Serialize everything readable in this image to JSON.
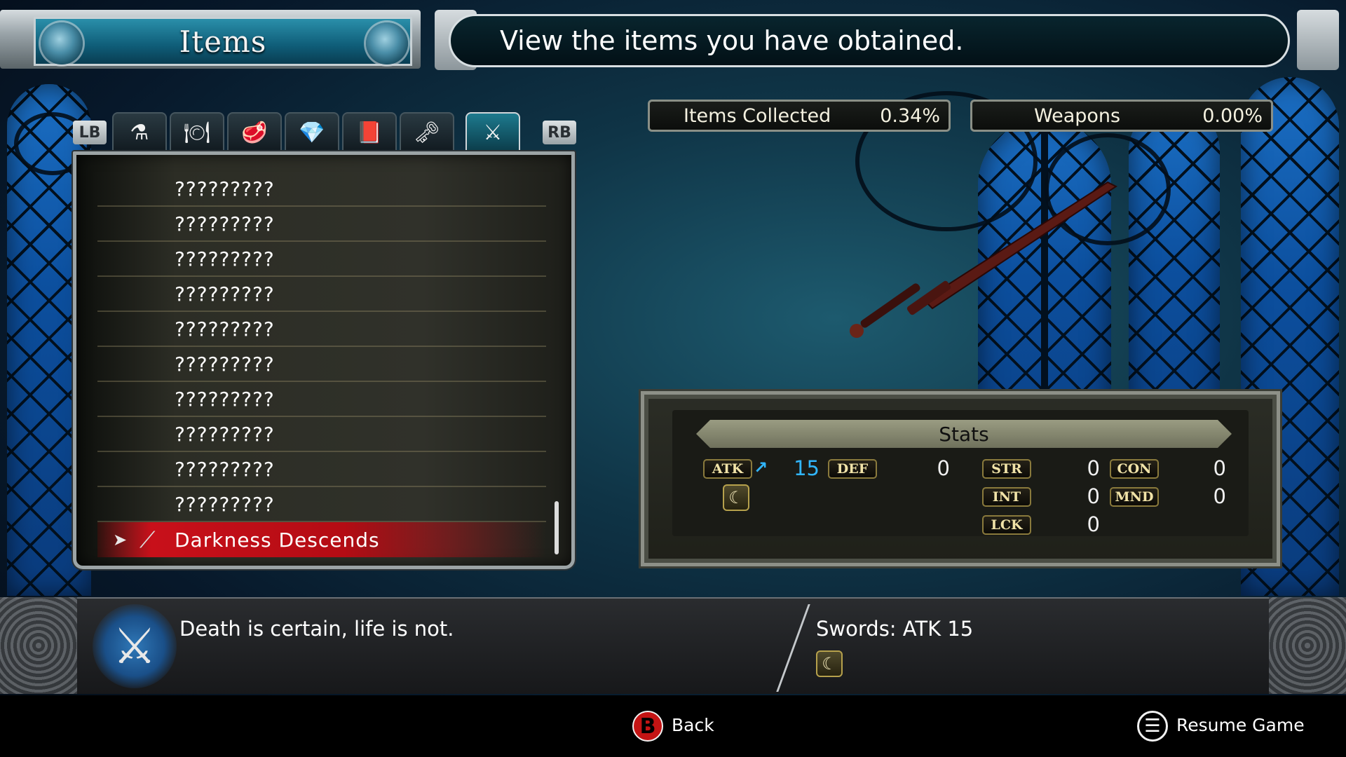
{
  "header": {
    "title": "Items",
    "description": "View the items you have obtained."
  },
  "tabs": {
    "left_bumper": "LB",
    "right_bumper": "RB",
    "items": [
      {
        "icon": "potion-icon",
        "glyph": "⚗"
      },
      {
        "icon": "food-plate-icon",
        "glyph": "🍽"
      },
      {
        "icon": "meat-icon",
        "glyph": "🥩"
      },
      {
        "icon": "crystal-ore-icon",
        "glyph": "💎"
      },
      {
        "icon": "book-icon",
        "glyph": "📕"
      },
      {
        "icon": "key-icon",
        "glyph": "🗝"
      },
      {
        "icon": "crossed-swords-icon",
        "glyph": "⚔",
        "active": true
      }
    ]
  },
  "item_list": [
    "?????????",
    "?????????",
    "?????????",
    "?????????",
    "?????????",
    "?????????",
    "?????????",
    "?????????",
    "?????????",
    "?????????",
    "Darkness Descends"
  ],
  "selected_index": 10,
  "completion": {
    "items_label": "Items Collected",
    "items_value": "0.34%",
    "category_label": "Weapons",
    "category_value": "0.00%"
  },
  "stats": {
    "header": "Stats",
    "atk_label": "ATK",
    "atk_value": "15",
    "def_label": "DEF",
    "def_value": "0",
    "str_label": "STR",
    "str_value": "0",
    "con_label": "CON",
    "con_value": "0",
    "int_label": "INT",
    "int_value": "0",
    "mnd_label": "MND",
    "mnd_value": "0",
    "lck_label": "LCK",
    "lck_value": "0"
  },
  "info": {
    "flavor_text": "Death is certain, life is not.",
    "weapon_type": "Swords: ATK 15"
  },
  "footer": {
    "b_button": "B",
    "back_label": "Back",
    "resume_label": "Resume Game"
  },
  "colors": {
    "selected_row": "#c8101a",
    "stat_increase": "#31b6ff",
    "title_plate": "#0f5d78"
  }
}
